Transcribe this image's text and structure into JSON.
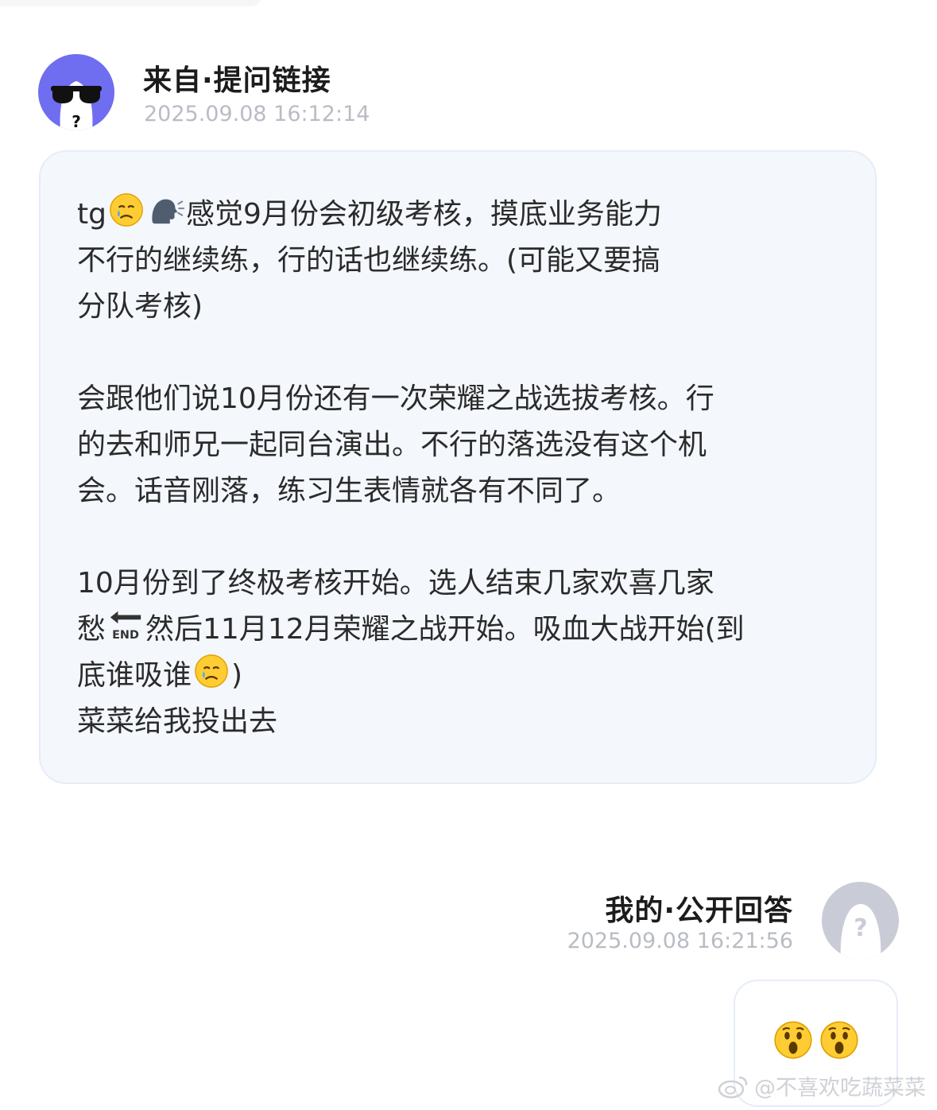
{
  "question": {
    "sender": "来自·提问链接",
    "time": "2025.09.08 16:12:14",
    "avatar_icon": "sunglasses-ghost-avatar-icon",
    "paragraphs": [
      {
        "lines": [
          {
            "prefix": "tg",
            "icons": [
              "crying-face-icon",
              "speaking-head-icon"
            ],
            "text": "感觉9月份会初级考核，摸底业务能力"
          },
          {
            "text": "不行的继续练，行的话也继续练。(可能又要搞"
          },
          {
            "text": "分队考核)"
          }
        ]
      },
      {
        "lines": [
          {
            "text": "会跟他们说10月份还有一次荣耀之战选拔考核。行"
          },
          {
            "text": "的去和师兄一起同台演出。不行的落选没有这个机"
          },
          {
            "text": "会。话音刚落，练习生表情就各有不同了。"
          }
        ]
      },
      {
        "lines": [
          {
            "text": "10月份到了终极考核开始。选人结束几家欢喜几家"
          },
          {
            "prefix": "愁",
            "icons": [
              "end-arrow-icon"
            ],
            "text": "然后11月12月荣耀之战开始。吸血大战开始(到"
          },
          {
            "prefix": "底谁吸谁",
            "icons": [
              "crying-face-icon"
            ],
            "text": ")"
          },
          {
            "text": "菜菜给我投出去"
          }
        ]
      }
    ]
  },
  "answer": {
    "label": "我的·公开回答",
    "time": "2025.09.08 16:21:56",
    "avatar_icon": "question-mark-ghost-avatar-icon",
    "content_icons": [
      "astonished-face-icon",
      "astonished-face-icon"
    ]
  },
  "watermark": {
    "text": "@不喜欢吃蔬菜菜",
    "icon": "weibo-logo-icon"
  },
  "colors": {
    "avatar_question_bg": "#6f6df0",
    "bubble_bg": "#f4f7fc",
    "timestamp": "#b9bcc4"
  }
}
